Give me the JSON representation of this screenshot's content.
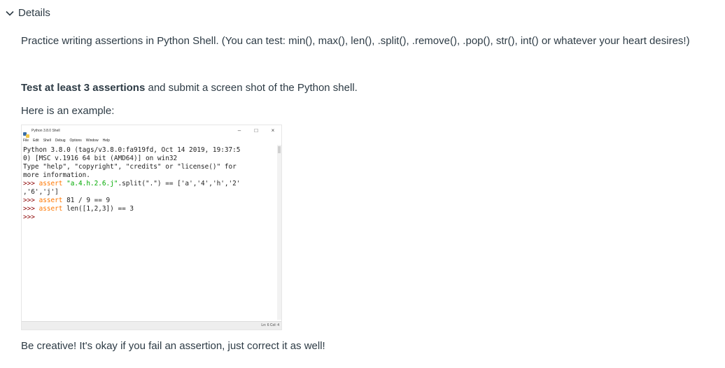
{
  "details": {
    "title": "Details"
  },
  "content": {
    "intro": "Practice writing assertions in Python Shell. (You can test: min(), max(), len(), .split(), .remove(), .pop(), str(), int() or whatever your heart desires!)",
    "task_bold": "Test at least 3 assertions",
    "task_rest": " and submit a screen shot of the Python shell.",
    "example_label": "Here is an example:",
    "closing": "Be creative! It's okay if you fail an assertion, just correct it as well!"
  },
  "shell": {
    "window_title": "Python 3.8.0 Shell",
    "window_buttons": [
      "–",
      "□",
      "×"
    ],
    "menu": [
      "File",
      "Edit",
      "Shell",
      "Debug",
      "Options",
      "Window",
      "Help"
    ],
    "banner": [
      "Python 3.8.0 (tags/v3.8.0:fa919fd, Oct 14 2019, 19:37:5",
      "0) [MSC v.1916 64 bit (AMD64)] on win32",
      "Type \"help\", \"copyright\", \"credits\" or \"license()\" for",
      "more information."
    ],
    "prompt": ">>> ",
    "keyword": "assert",
    "line1_string": "\"a.4.h.2.6.j\"",
    "line1_rest": ".split(\".\") == ['a','4','h','2'",
    "line1_cont": ",'6','j']",
    "line2_rest": " 81 / 9 == 9",
    "line3_rest": " len([1,2,3]) == 3",
    "status": "Ln: 6  Col: 4"
  }
}
